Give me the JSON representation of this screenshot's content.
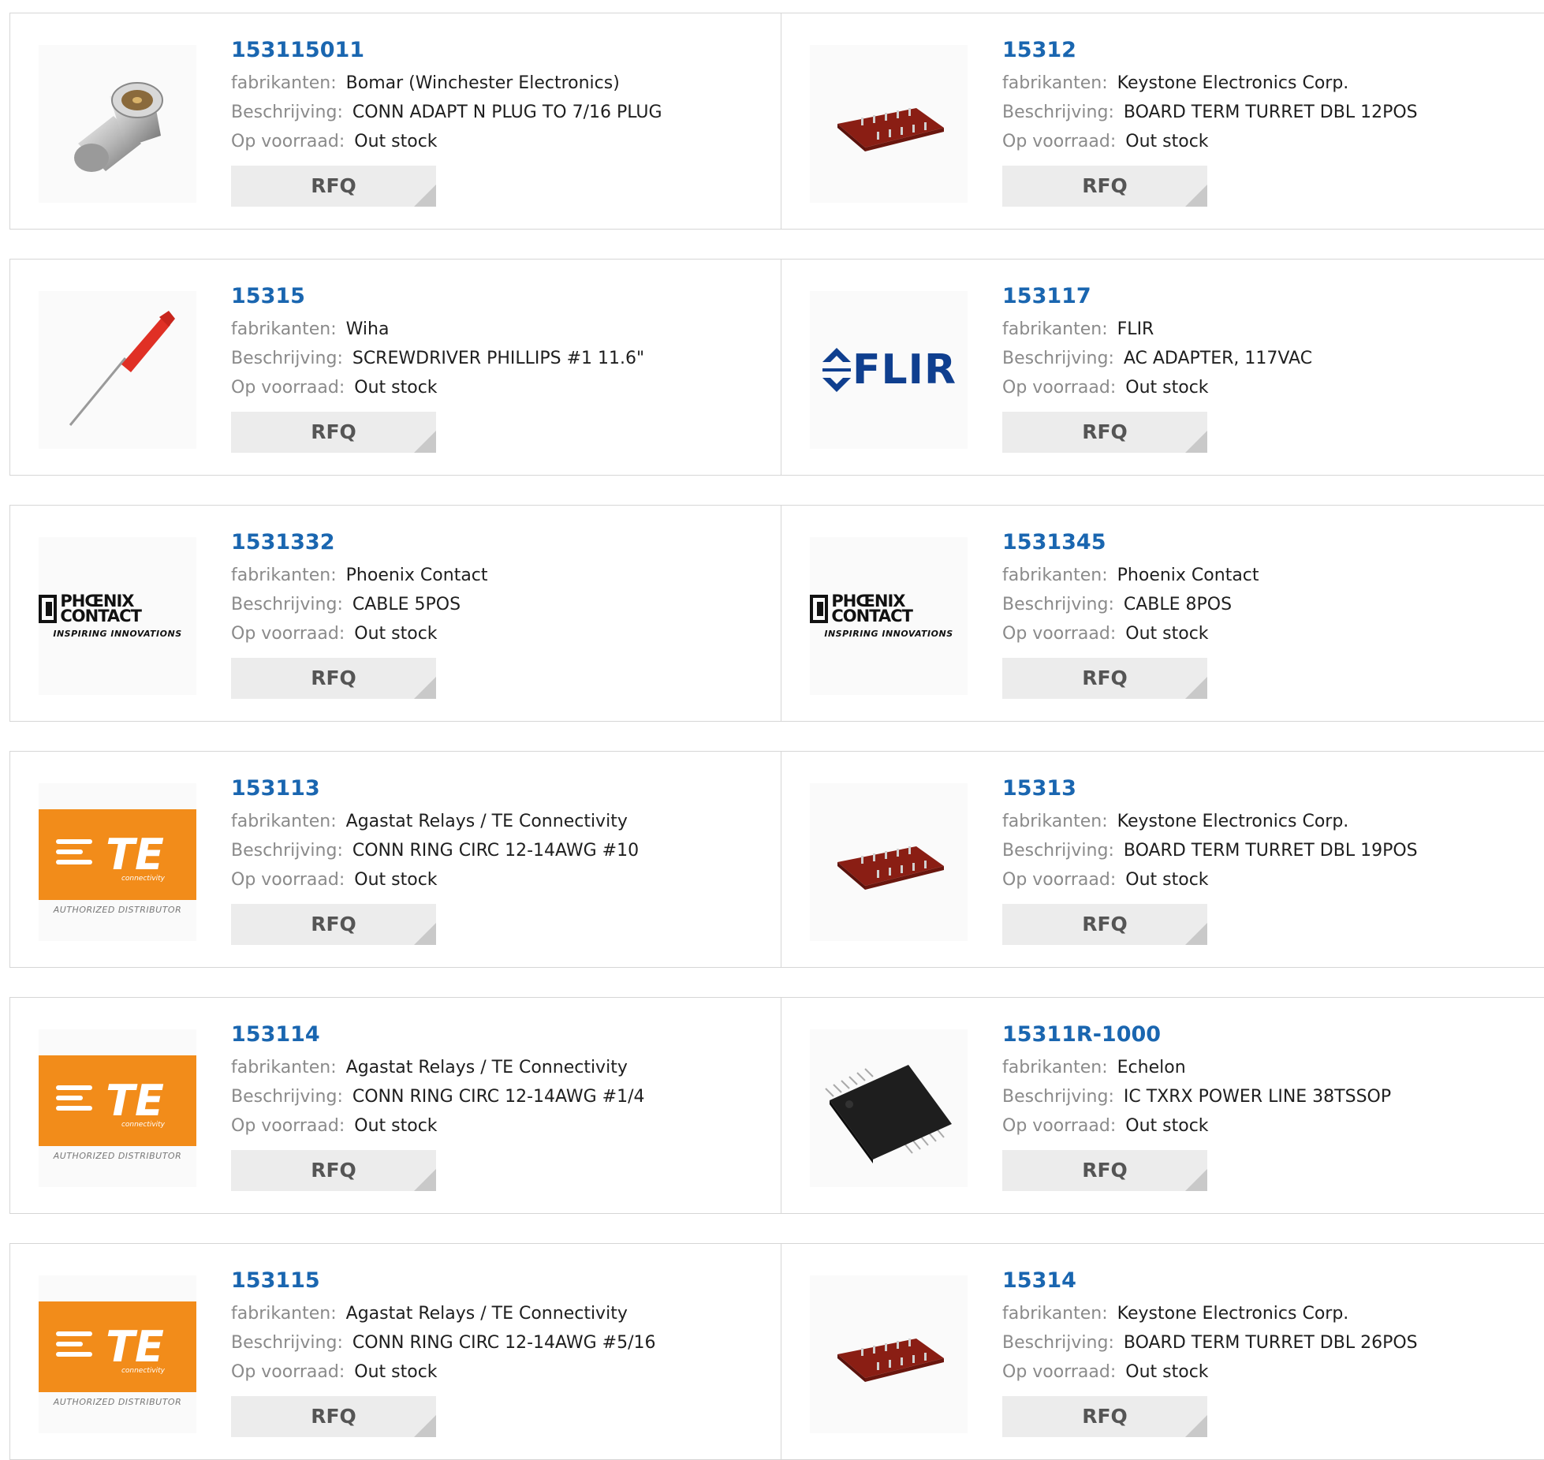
{
  "labels": {
    "manufacturer": "fabrikanten:",
    "description": "Beschrijving:",
    "stock": "Op voorraad:",
    "rfq": "RFQ"
  },
  "products": [
    {
      "part_number": "153115011",
      "manufacturer": "Bomar (Winchester Electronics)",
      "description": "CONN ADAPT N PLUG TO 7/16 PLUG",
      "stock": "Out stock",
      "image": "n-adapter-connector"
    },
    {
      "part_number": "15312",
      "manufacturer": "Keystone Electronics Corp.",
      "description": "BOARD TERM TURRET DBL 12POS",
      "stock": "Out stock",
      "image": "turret-board"
    },
    {
      "part_number": "15315",
      "manufacturer": "Wiha",
      "description": "SCREWDRIVER PHILLIPS #1 11.6\"",
      "stock": "Out stock",
      "image": "screwdriver"
    },
    {
      "part_number": "153117",
      "manufacturer": "FLIR",
      "description": "AC ADAPTER, 117VAC",
      "stock": "Out stock",
      "image": "flir-logo",
      "logo_text": "FLIR"
    },
    {
      "part_number": "1531332",
      "manufacturer": "Phoenix Contact",
      "description": "CABLE 5POS",
      "stock": "Out stock",
      "image": "phoenix-contact-logo",
      "logo_text": "PHŒNIX CONTACT",
      "logo_tagline": "INSPIRING INNOVATIONS"
    },
    {
      "part_number": "1531345",
      "manufacturer": "Phoenix Contact",
      "description": "CABLE 8POS",
      "stock": "Out stock",
      "image": "phoenix-contact-logo",
      "logo_text": "PHŒNIX CONTACT",
      "logo_tagline": "INSPIRING INNOVATIONS"
    },
    {
      "part_number": "153113",
      "manufacturer": "Agastat Relays / TE Connectivity",
      "description": "CONN RING CIRC 12-14AWG #10",
      "stock": "Out stock",
      "image": "te-connectivity-logo",
      "logo_text": "TE",
      "logo_sub": "connectivity",
      "logo_tagline": "AUTHORIZED DISTRIBUTOR"
    },
    {
      "part_number": "15313",
      "manufacturer": "Keystone Electronics Corp.",
      "description": "BOARD TERM TURRET DBL 19POS",
      "stock": "Out stock",
      "image": "turret-board"
    },
    {
      "part_number": "153114",
      "manufacturer": "Agastat Relays / TE Connectivity",
      "description": "CONN RING CIRC 12-14AWG #1/4",
      "stock": "Out stock",
      "image": "te-connectivity-logo",
      "logo_text": "TE",
      "logo_sub": "connectivity",
      "logo_tagline": "AUTHORIZED DISTRIBUTOR"
    },
    {
      "part_number": "15311R-1000",
      "manufacturer": "Echelon",
      "description": "IC TXRX POWER LINE 38TSSOP",
      "stock": "Out stock",
      "image": "tssop-chip"
    },
    {
      "part_number": "153115",
      "manufacturer": "Agastat Relays / TE Connectivity",
      "description": "CONN RING CIRC 12-14AWG #5/16",
      "stock": "Out stock",
      "image": "te-connectivity-logo",
      "logo_text": "TE",
      "logo_sub": "connectivity",
      "logo_tagline": "AUTHORIZED DISTRIBUTOR"
    },
    {
      "part_number": "15314",
      "manufacturer": "Keystone Electronics Corp.",
      "description": "BOARD TERM TURRET DBL 26POS",
      "stock": "Out stock",
      "image": "turret-board"
    }
  ],
  "colors": {
    "part_number": "#1a66b0",
    "label": "#8a8a8a",
    "rfq_bg": "#ececec",
    "te_orange": "#f28c1a",
    "flir_blue": "#0f3f8f"
  }
}
